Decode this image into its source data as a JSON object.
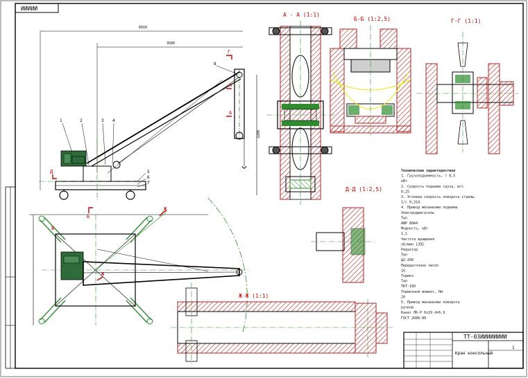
{
  "drawing": {
    "stamp_top": "ИИИИИ",
    "title_code": "ТТ-03ИИИИИИИИ",
    "title_name": "Кран консольный",
    "sheet": "1",
    "dim_overall": "6010",
    "dim_span": "3500",
    "dim_height": "3200"
  },
  "sections": {
    "aa": "А - А (1:1)",
    "bb": "Б-Б (1:2,5)",
    "gg": "Г-Г (1:1)",
    "dd": "Д-Д (1:2,5)",
    "zhzh": "Ж-Ж (1:1)"
  },
  "view_labels": {
    "g": "Г",
    "a": "А",
    "b": "Б",
    "d": "Д",
    "zh": "Ж",
    "v": "В"
  },
  "part_numbers": [
    "1",
    "2",
    "3",
    "4",
    "5",
    "6",
    "7",
    "8"
  ],
  "specs": [
    {
      "t": "Технические характеристики",
      "b": true
    },
    {
      "t": "1. Грузоподъемность, т    0,5"
    },
    {
      "t": "кВт"
    },
    {
      "t": "2. Скорость подъема груза, м/с"
    },
    {
      "t": "0,25"
    },
    {
      "t": "3. Угловая скорость поворота стрелы"
    },
    {
      "t": "1/с        0,314"
    },
    {
      "t": "4. Привод механизма подъема"
    },
    {
      "t": "   Электродвигатель"
    },
    {
      "t": "                   Тип"
    },
    {
      "t": "АИР 80А4"
    },
    {
      "t": "       Мощность, кВт"
    },
    {
      "t": "1,1"
    },
    {
      "t": "          Частота вращения"
    },
    {
      "t": "об/мин       1395"
    },
    {
      "t": "          Редуктор"
    },
    {
      "t": "              Тип"
    },
    {
      "t": "Ц2-200"
    },
    {
      "t": "         Передаточное число"
    },
    {
      "t": "16"
    },
    {
      "t": "         Тормоз"
    },
    {
      "t": "              Тип"
    },
    {
      "t": "ТКТ-100"
    },
    {
      "t": "         Тормозной момент, Нм"
    },
    {
      "t": "20"
    },
    {
      "t": "5. Привод механизма поворота"
    },
    {
      "t": "   ручной"
    },
    {
      "t": "Канат  ЛК-Р 6х19 d=6,9"
    },
    {
      "t": "ГОСТ 2688-80"
    }
  ]
}
